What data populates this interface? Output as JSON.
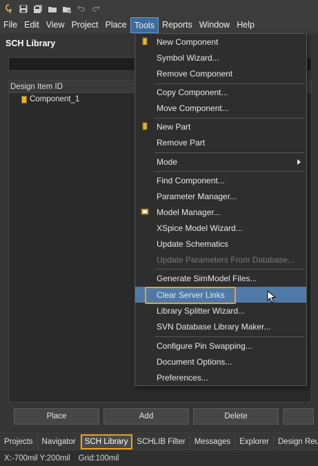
{
  "menubar": {
    "items": [
      "File",
      "Edit",
      "View",
      "Project",
      "Place",
      "Tools",
      "Reports",
      "Window",
      "Help"
    ]
  },
  "panel": {
    "title": "SCH Library",
    "search_value": "",
    "list_header": "Design Item ID",
    "components": [
      "Component_1"
    ],
    "buttons": [
      "Place",
      "Add",
      "Delete",
      ""
    ]
  },
  "tools_menu": {
    "items": [
      {
        "label": "New Component",
        "icon": "component-icon",
        "disabled": false
      },
      {
        "label": "Symbol Wizard...",
        "icon": "",
        "disabled": false
      },
      {
        "label": "Remove Component",
        "icon": "",
        "disabled": false
      },
      {
        "label": "Copy Component...",
        "icon": "",
        "disabled": false
      },
      {
        "label": "Move Component...",
        "icon": "",
        "disabled": false
      },
      {
        "label": "New Part",
        "icon": "part-icon",
        "disabled": false
      },
      {
        "label": "Remove Part",
        "icon": "",
        "disabled": false
      },
      {
        "label": "Mode",
        "icon": "",
        "disabled": false,
        "submenu": true
      },
      {
        "label": "Find Component...",
        "icon": "",
        "disabled": false
      },
      {
        "label": "Parameter Manager...",
        "icon": "",
        "disabled": false
      },
      {
        "label": "Model Manager...",
        "icon": "model-manager-icon",
        "disabled": false
      },
      {
        "label": "XSpice Model Wizard...",
        "icon": "",
        "disabled": false
      },
      {
        "label": "Update Schematics",
        "icon": "",
        "disabled": false
      },
      {
        "label": "Update Parameters From Database...",
        "icon": "",
        "disabled": true
      },
      {
        "label": "Generate SimModel Files...",
        "icon": "",
        "disabled": false
      },
      {
        "label": "Clear Server Links",
        "icon": "",
        "disabled": false,
        "hovered": true
      },
      {
        "label": "Library Splitter Wizard...",
        "icon": "",
        "disabled": false
      },
      {
        "label": "SVN Database Library Maker...",
        "icon": "",
        "disabled": false
      },
      {
        "label": "Configure Pin Swapping...",
        "icon": "",
        "disabled": false
      },
      {
        "label": "Document Options...",
        "icon": "",
        "disabled": false
      },
      {
        "label": "Preferences...",
        "icon": "",
        "disabled": false
      }
    ]
  },
  "tabs": [
    "Projects",
    "Navigator",
    "SCH Library",
    "SCHLIB Filter",
    "Messages",
    "Explorer",
    "Design Reuse"
  ],
  "active_tab": "SCH Library",
  "status": {
    "coords": "X:-700mil Y:200mil",
    "grid": "Grid:100mil"
  },
  "colors": {
    "highlight": "#f0a020",
    "menu_hover": "#4f7aa8",
    "menubar_active": "#3e6c9c"
  }
}
